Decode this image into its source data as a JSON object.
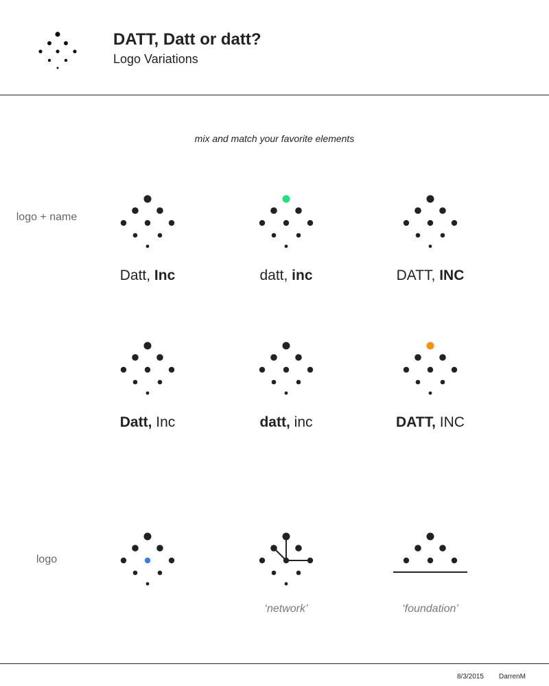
{
  "header": {
    "title": "DATT, Datt or datt?",
    "subtitle": "Logo Variations"
  },
  "tagline": "mix and match your favorite elements",
  "rows": {
    "logo_name_label": "logo + name",
    "logo_label": "logo"
  },
  "variants": [
    {
      "regular": "Datt, ",
      "bold": "Inc",
      "accent": "none"
    },
    {
      "regular": "datt, ",
      "bold": "inc",
      "accent": "green"
    },
    {
      "regular": "DATT, ",
      "bold": "INC",
      "accent": "none"
    },
    {
      "bold": "Datt, ",
      "regular": "Inc",
      "accent": "none"
    },
    {
      "bold": "datt, ",
      "regular": "inc",
      "accent": "none"
    },
    {
      "bold": "DATT, ",
      "regular": "INC",
      "accent": "orange"
    }
  ],
  "logo_only": [
    {
      "style": "blue-center",
      "caption": ""
    },
    {
      "style": "network",
      "caption": "‘network’"
    },
    {
      "style": "foundation",
      "caption": "‘foundation’"
    }
  ],
  "colors": {
    "dot": "#222222",
    "green": "#1ee37a",
    "orange": "#f7910f",
    "blue": "#3a7fe0"
  },
  "footer": {
    "date": "8/3/2015",
    "author": "DarrenM"
  }
}
